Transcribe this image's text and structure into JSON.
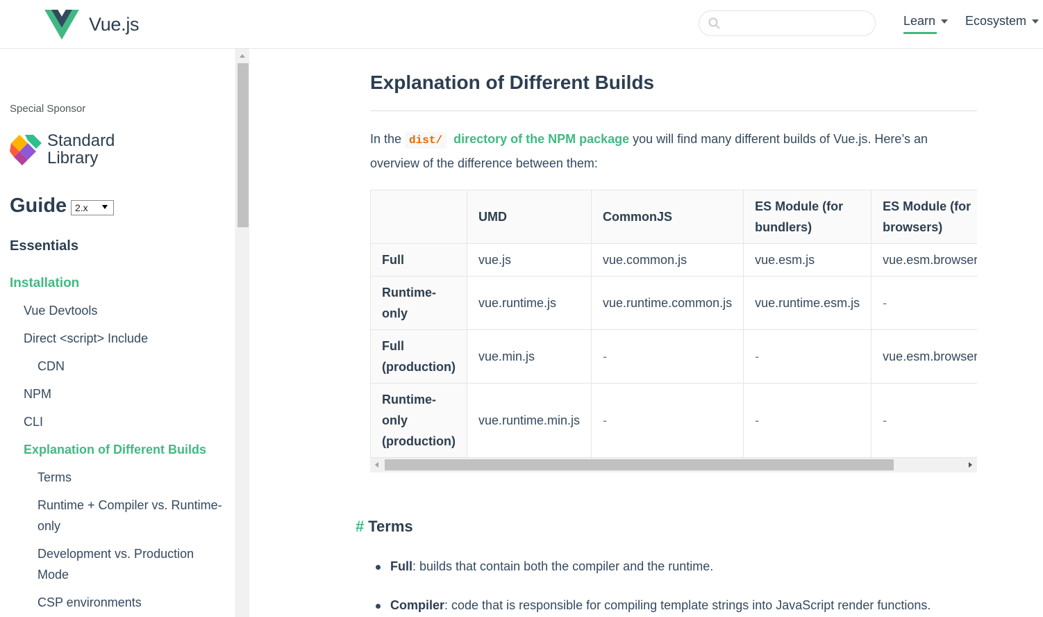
{
  "header": {
    "brand": "Vue.js",
    "search_placeholder": "",
    "nav": [
      {
        "label": "Learn"
      },
      {
        "label": "Ecosystem"
      }
    ]
  },
  "sidebar": {
    "sponsor_label": "Special Sponsor",
    "sponsor_name_line1": "Standard",
    "sponsor_name_line2": "Library",
    "guide_title": "Guide",
    "version": "2.x",
    "section_title": "Essentials",
    "items": [
      {
        "label": "Installation"
      },
      {
        "label": "Vue Devtools"
      },
      {
        "label": "Direct <script> Include"
      },
      {
        "label": "CDN"
      },
      {
        "label": "NPM"
      },
      {
        "label": "CLI"
      },
      {
        "label": "Explanation of Different Builds"
      },
      {
        "label": "Terms"
      },
      {
        "label": "Runtime + Compiler vs. Runtime-only"
      },
      {
        "label": "Development vs. Production Mode"
      },
      {
        "label": "CSP environments"
      }
    ]
  },
  "content": {
    "heading": "Explanation of Different Builds",
    "intro_before": "In the ",
    "intro_code": "dist/",
    "intro_link": "directory of the NPM package",
    "intro_after": " you will find many different builds of Vue.js. Here’s an overview of the difference between them:",
    "table": {
      "headers": [
        "",
        "UMD",
        "CommonJS",
        "ES Module (for bundlers)",
        "ES Module (for browsers)"
      ],
      "rows": [
        [
          "Full",
          "vue.js",
          "vue.common.js",
          "vue.esm.js",
          "vue.esm.browser.js"
        ],
        [
          "Runtime-only",
          "vue.runtime.js",
          "vue.runtime.common.js",
          "vue.runtime.esm.js",
          "-"
        ],
        [
          "Full (production)",
          "vue.min.js",
          "-",
          "-",
          "vue.esm.browser.min.js"
        ],
        [
          "Runtime-only (production)",
          "vue.runtime.min.js",
          "-",
          "-",
          "-"
        ]
      ]
    },
    "terms_hash": "#",
    "terms_heading": "Terms",
    "bullets": [
      {
        "term": "Full",
        "text": ": builds that contain both the compiler and the runtime."
      },
      {
        "term": "Compiler",
        "text": ": code that is responsible for compiling template strings into JavaScript render functions."
      }
    ]
  },
  "colors": {
    "accent": "#42b983",
    "text": "#34495e",
    "heading": "#2c3e50",
    "code": "#e96900"
  }
}
